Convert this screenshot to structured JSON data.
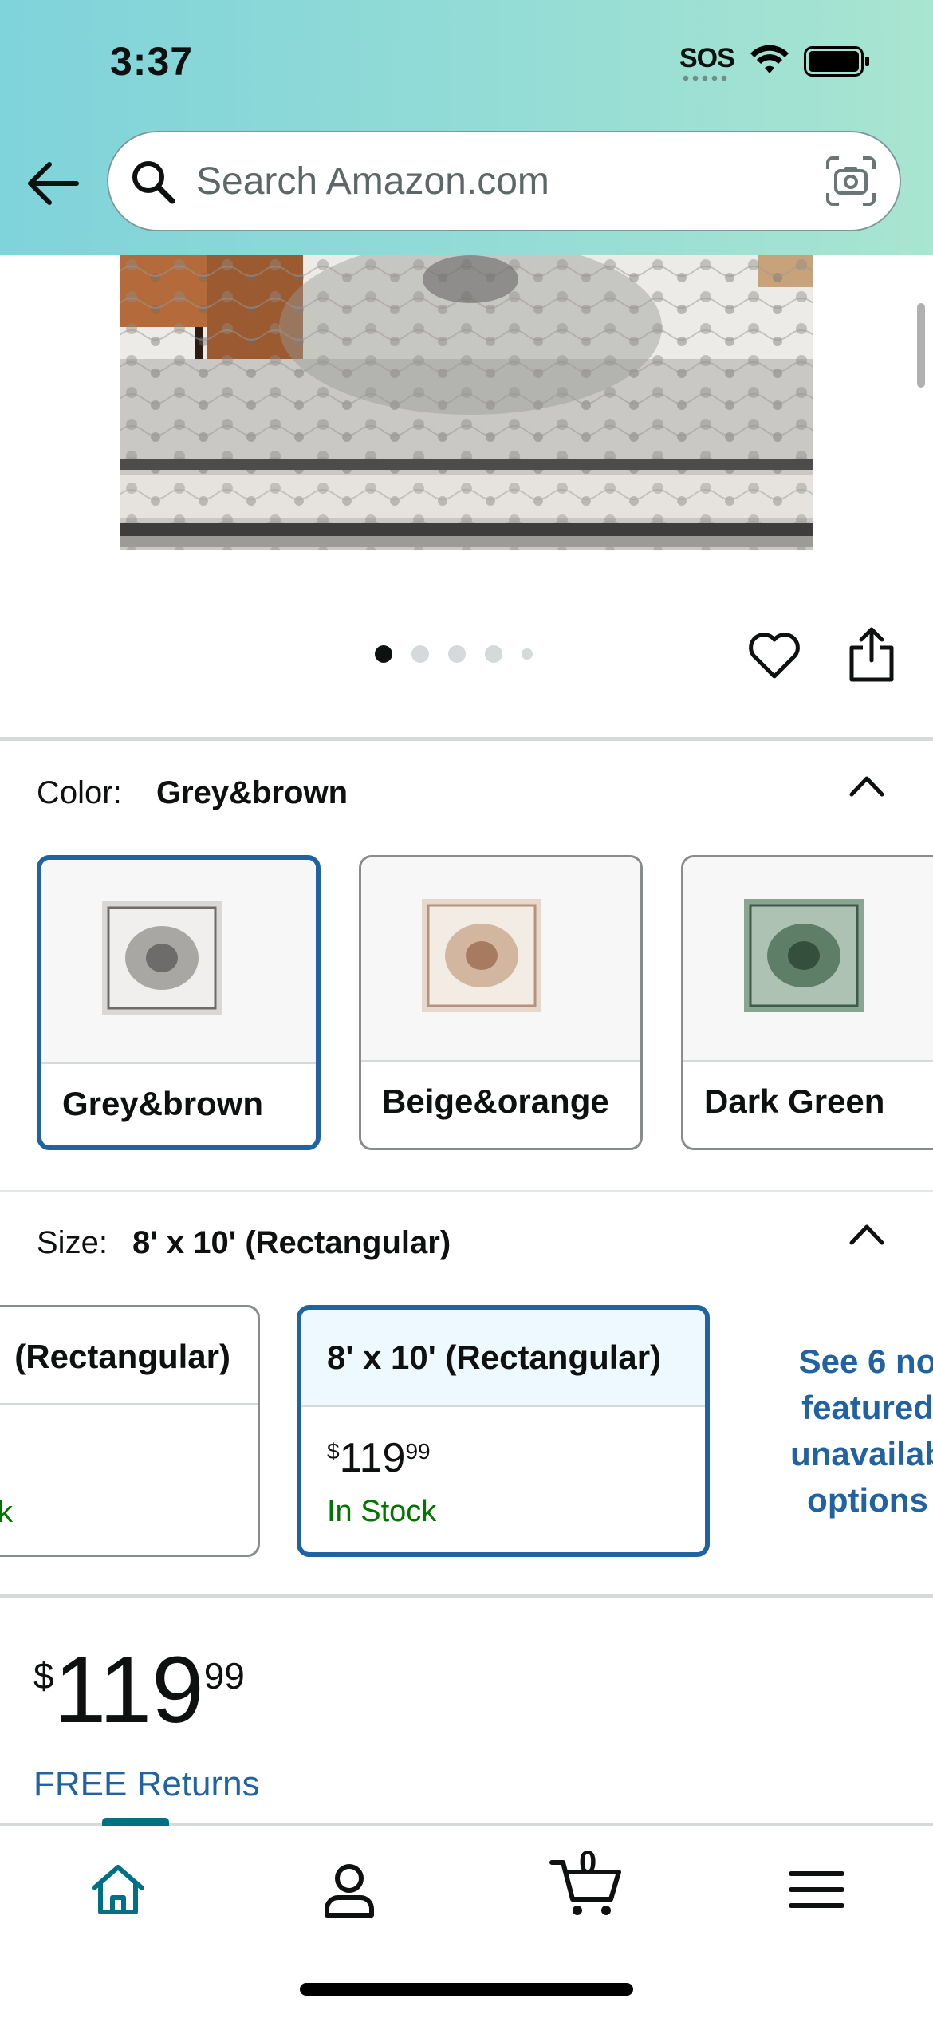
{
  "status_bar": {
    "time": "3:37",
    "sos": "SOS"
  },
  "header": {
    "search_placeholder": "Search Amazon.com"
  },
  "image_carousel": {
    "total_dots": 5,
    "active_index": 0
  },
  "color": {
    "label": "Color:",
    "selected": "Grey&brown",
    "options": [
      {
        "name": "Grey&brown",
        "selected": true
      },
      {
        "name": "Beige&orange",
        "selected": false
      },
      {
        "name": "Dark Green",
        "selected": false
      }
    ]
  },
  "size": {
    "label": "Size:",
    "selected": "8' x 10' (Rectangular)",
    "options": [
      {
        "name": "(Rectangular)",
        "stock": "k",
        "selected": false
      },
      {
        "name": "8' x 10' (Rectangular)",
        "price_symbol": "$",
        "price_whole": "119",
        "price_fraction": "99",
        "stock": "In Stock",
        "selected": true
      }
    ],
    "more_options_lines": [
      "See 6 no",
      "featured",
      "unavailab",
      "options"
    ]
  },
  "price": {
    "symbol": "$",
    "whole": "119",
    "fraction": "99"
  },
  "free_returns": "FREE Returns",
  "bottom_nav": {
    "cart_count": "0"
  },
  "colors": {
    "link": "#2162a1",
    "stock_green": "#007600",
    "teal": "#007185"
  }
}
